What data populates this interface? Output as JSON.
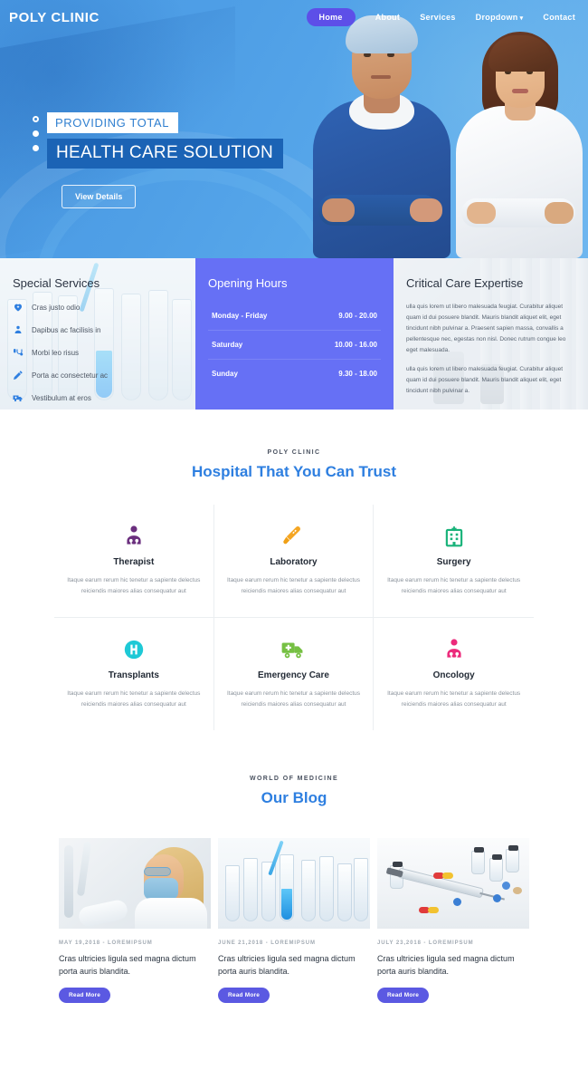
{
  "nav": {
    "brand": "POLY CLINIC",
    "items": [
      {
        "label": "Home",
        "active": true,
        "caret": ""
      },
      {
        "label": "About",
        "active": false,
        "caret": ""
      },
      {
        "label": "Services",
        "active": false,
        "caret": ""
      },
      {
        "label": "Dropdown",
        "active": false,
        "caret": "▾"
      },
      {
        "label": "Contact",
        "active": false,
        "caret": ""
      }
    ]
  },
  "hero": {
    "subtitle": "PROVIDING TOTAL",
    "title": "HEALTH CARE SOLUTION",
    "button": "View Details",
    "slider_dots": 3,
    "active_dot": 0
  },
  "panels": {
    "special_services": {
      "title": "Special Services",
      "items": [
        {
          "label": "Cras justo odio",
          "icon": "heart-icon"
        },
        {
          "label": "Dapibus ac facilisis in",
          "icon": "person-icon"
        },
        {
          "label": "Morbi leo risus",
          "icon": "stethoscope-icon"
        },
        {
          "label": "Porta ac consectetur ac",
          "icon": "syringe-icon"
        },
        {
          "label": "Vestibulum at eros",
          "icon": "ambulance-icon"
        }
      ]
    },
    "opening_hours": {
      "title": "Opening Hours",
      "rows": [
        {
          "day": "Monday - Friday",
          "time": "9.00 - 20.00"
        },
        {
          "day": "Saturday",
          "time": "10.00 - 16.00"
        },
        {
          "day": "Sunday",
          "time": "9.30 -  18.00"
        }
      ]
    },
    "critical_care": {
      "title": "Critical Care Expertise",
      "paragraph1": "ulla quis lorem ut libero malesuada feugiat. Curabitur aliquet quam id dui posuere blandit. Mauris blandit aliquet elit, eget tincidunt nibh pulvinar a. Praesent sapien massa, convallis a pellentesque nec, egestas non nisl. Donec rutrum congue leo eget malesuada.",
      "paragraph2": "ulla quis lorem ut libero malesuada feugiat. Curabitur aliquet quam id dui posuere blandit. Mauris blandit aliquet elit, eget tincidunt nibh pulvinar a."
    }
  },
  "services_section": {
    "eyebrow": "POLY CLINIC",
    "title": "Hospital That You Can Trust",
    "cards": [
      {
        "name": "Therapist",
        "icon": "doctor-purple-icon",
        "desc": "Itaque earum rerum hic tenetur a sapiente delectus reiciendis maiores alias consequatur aut"
      },
      {
        "name": "Laboratory",
        "icon": "thermometer-orange-icon",
        "desc": "Itaque earum rerum hic tenetur a sapiente delectus reiciendis maiores alias consequatur aut"
      },
      {
        "name": "Surgery",
        "icon": "hospital-green-icon",
        "desc": "Itaque earum rerum hic tenetur a sapiente delectus reiciendis maiores alias consequatur aut"
      },
      {
        "name": "Transplants",
        "icon": "hospital-h-cyan-icon",
        "desc": "Itaque earum rerum hic tenetur a sapiente delectus reiciendis maiores alias consequatur aut"
      },
      {
        "name": "Emergency Care",
        "icon": "ambulance-green-icon",
        "desc": "Itaque earum rerum hic tenetur a sapiente delectus reiciendis maiores alias consequatur aut"
      },
      {
        "name": "Oncology",
        "icon": "doctor-pink-icon",
        "desc": "Itaque earum rerum hic tenetur a sapiente delectus reiciendis maiores alias consequatur aut"
      }
    ]
  },
  "blog_section": {
    "eyebrow": "WORLD OF MEDICINE",
    "title": "Our Blog",
    "posts": [
      {
        "meta": "MAY  19,2018  -  LOREMIPSUM",
        "title": "Cras ultricies ligula sed magna dictum porta auris blandita.",
        "button": "Read More",
        "image": "scientist-in-lab-photo"
      },
      {
        "meta": "JUNE  21,2018  -  LOREMIPSUM",
        "title": "Cras ultricies ligula sed magna dictum porta auris blandita.",
        "button": "Read More",
        "image": "test-tubes-blue-liquid-photo"
      },
      {
        "meta": "JULY  23,2018  -  LOREMIPSUM",
        "title": "Cras ultricies ligula sed magna dictum porta auris blandita.",
        "button": "Read More",
        "image": "syringe-vials-pills-photo"
      }
    ]
  },
  "colors": {
    "hero_blue": "#4a9ae4",
    "hero_title_bg": "#1b63b5",
    "nav_active": "#5d4fe8",
    "hours_panel": "#6670f5",
    "accent_blue": "#2e7fe0",
    "read_more": "#5b59e2",
    "therapist_purple": "#6b2f7e",
    "lab_orange": "#f5a623",
    "surgery_green": "#19b37a",
    "transplant_cyan": "#1ec9d6",
    "emergency_green": "#76c043",
    "oncology_pink": "#ec2a7b"
  }
}
